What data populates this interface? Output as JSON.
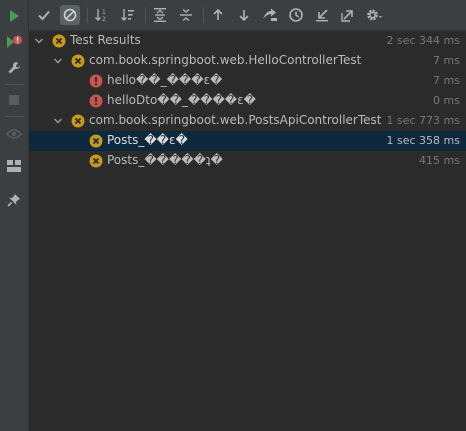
{
  "toolbar": {
    "icons": [
      "check-icon",
      "no-entry-icon",
      "sort-alpha-icon",
      "sort-duration-icon",
      "expand-all-icon",
      "collapse-all-icon",
      "arrow-up-icon",
      "arrow-down-icon",
      "rerun-icon",
      "history-icon",
      "import-icon",
      "export-icon",
      "gear-icon"
    ]
  },
  "tree": {
    "root": {
      "label": "Test Results",
      "duration": "2 sec 344 ms"
    },
    "classes": [
      {
        "label": "com.book.springboot.web.HelloControllerTest",
        "duration": "7 ms",
        "tests": [
          {
            "label": "hello\u0000\u0000_\u0000\u0000\u0000\u0000Ʒ\u0000",
            "display": "hello��_���ɛ�",
            "duration": "7 ms",
            "status": "error"
          },
          {
            "label": "helloDto��_����ɛ�",
            "duration": "0 ms",
            "status": "error"
          }
        ]
      },
      {
        "label": "com.book.springboot.web.PostsApiControllerTest",
        "duration": "1 sec 773 ms",
        "tests": [
          {
            "label": "Posts_��ɛ�",
            "duration": "1 sec 358 ms",
            "status": "failed"
          },
          {
            "label": "Posts_�����ʇ�",
            "duration": "415 ms",
            "status": "failed"
          }
        ]
      }
    ]
  },
  "colors": {
    "fail": "#c8991f",
    "error": "#c75450",
    "run": "#499c54",
    "selected_row": "#0d293e"
  }
}
